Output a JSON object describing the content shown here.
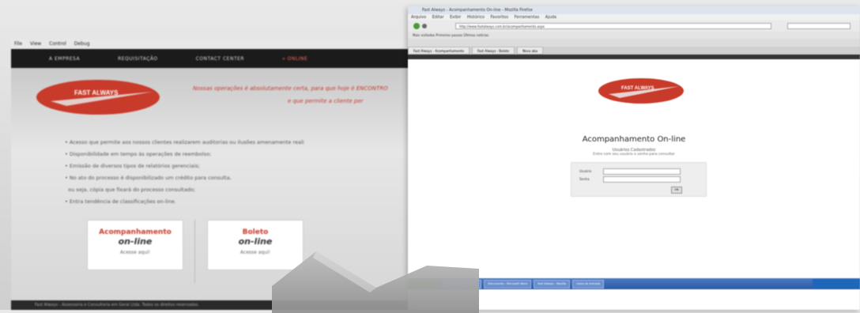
{
  "left_site": {
    "menubar": [
      "File",
      "View",
      "Control",
      "Debug"
    ],
    "nav": [
      "A EMPRESA",
      "REQUISITAÇÃO",
      "CONTACT CENTER",
      "» ONLINE"
    ],
    "logo_text": "FAST ALWAYS",
    "tagline_1": "Nossas operações é absolutamente certa, para que hoje é ENCONTRO",
    "tagline_2": "e que permite a cliente per",
    "bullets": [
      "Acesso que permite aos nossos clientes realizarem auditorias ou ilusões amenamente reali",
      "Disponibilidade em tempo às operações de reembolso;",
      "Emissão de diversos tipos de relatórios gerenciais;",
      "No ato do processo é disponibilizado um crédito para consulta,",
      "ou seja, cópia que fixará do processo consultado;",
      "Entra tendência de classificações on-line."
    ],
    "card_left": {
      "title": "Acompanhamento",
      "sub": "on-line",
      "link": "Acesse aqui!"
    },
    "card_right": {
      "title": "Boleto",
      "sub": "on-line",
      "link": "Acesse aqui!"
    },
    "footer": "Fast Always - Assessoria e Consultoria em Geral Ltda. Todos os direitos reservados."
  },
  "right_browser": {
    "window_title": "Fast Always - Acompanhamento On-line - Mozilla Firefox",
    "menu": [
      "Arquivo",
      "Editar",
      "Exibir",
      "Histórico",
      "Favoritos",
      "Ferramentas",
      "Ajuda"
    ],
    "url": "http://www.fastalways.com.br/acompanhamento.aspx",
    "bookmarks": "Mais visitados  Primeiros passos  Últimas notícias",
    "tabs": [
      "Fast Always - Acompanhamento",
      "Fast Always - Boleto",
      "Nova aba"
    ],
    "page_logo": "FAST ALWAYS",
    "page_title": "Acompanhamento On-line",
    "page_sub1": "Usuários Cadastrados",
    "page_sub2": "Entre com seu usuário e senha para consultar",
    "login_user_label": "Usuário",
    "login_pass_label": "Senha",
    "login_button": "OK",
    "taskbar_items": [
      "Fast Always - Acomp...",
      "Documento - Microsoft Word",
      "Fast Always - Mozilla",
      "Caixa de entrada"
    ]
  },
  "colors": {
    "accent_red": "#c83a2a",
    "nav_dark": "#1b1b1b"
  }
}
